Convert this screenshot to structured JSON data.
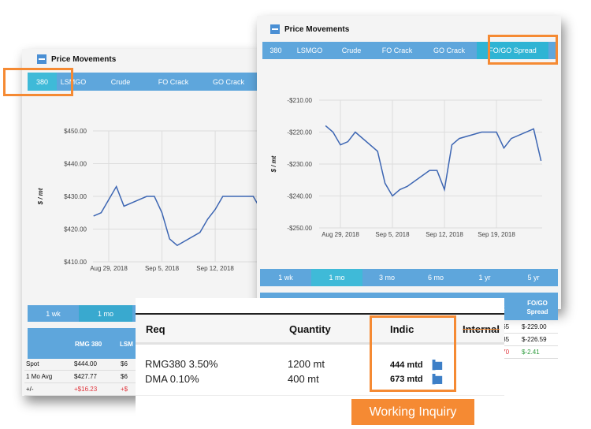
{
  "left_panel": {
    "title": "Price Movements",
    "tabs": [
      "380",
      "LSMGO",
      "Crude",
      "FO Crack",
      "GO Crack"
    ],
    "active_tab": "380",
    "periods": [
      "1 wk",
      "1 mo"
    ],
    "active_period": "1 mo",
    "table": {
      "headers": [
        "",
        "RMG 380",
        "LSM"
      ],
      "rows": [
        {
          "label": "Spot",
          "v1": "$444.00",
          "v2": "$6"
        },
        {
          "label": "1 Mo Avg",
          "v1": "$427.77",
          "v2": "$6"
        },
        {
          "label": "+/-",
          "v1": "+$16.23",
          "v2": "+$"
        }
      ]
    }
  },
  "right_panel": {
    "title": "Price Movements",
    "tabs": [
      "380",
      "LSMGO",
      "Crude",
      "FO Crack",
      "GO Crack",
      "FO/GO Spread"
    ],
    "active_tab": "FO/GO Spread",
    "periods": [
      "1 wk",
      "1 mo",
      "3 mo",
      "6 mo",
      "1 yr",
      "5 yr"
    ],
    "active_period": "1 mo",
    "table": {
      "headers": [
        "k",
        "FO/GO Spread"
      ],
      "rows": [
        {
          "v1": ".65",
          "v2": "$-229.00"
        },
        {
          "v1": ".35",
          "v2": "$-226.59"
        },
        {
          "v1": ".70",
          "v2": "$-2.41"
        }
      ]
    }
  },
  "inquiry": {
    "headers": {
      "req": "Req",
      "quantity": "Quantity",
      "indic": "Indic",
      "internal": "Internal"
    },
    "rows": [
      {
        "req": "RMG380 3.50%",
        "quantity": "1200 mt",
        "indic": "444 mtd"
      },
      {
        "req": "DMA 0.10%",
        "quantity": "400 mt",
        "indic": "673 mtd"
      }
    ],
    "badge": "Working Inquiry"
  },
  "colors": {
    "accent": "#f58a33",
    "tab": "#5ea6dc",
    "tab_active": "#3fbad8",
    "line": "#3d66b3",
    "negative": "#e0333a",
    "positive": "#2a9a3a"
  },
  "chart_data": [
    {
      "type": "line",
      "ylabel": "$ / mt",
      "ylim": [
        410,
        450
      ],
      "yticks": [
        "$410.00",
        "$420.00",
        "$430.00",
        "$440.00",
        "$450.00"
      ],
      "xticks": [
        "Aug 29, 2018",
        "Sep 5, 2018",
        "Sep 12, 2018",
        "Sep"
      ],
      "grid": true,
      "x": [
        "2018-08-27",
        "2018-08-28",
        "2018-08-30",
        "2018-08-31",
        "2018-09-03",
        "2018-09-04",
        "2018-09-05",
        "2018-09-06",
        "2018-09-07",
        "2018-09-10",
        "2018-09-11",
        "2018-09-12",
        "2018-09-13",
        "2018-09-17",
        "2018-09-18"
      ],
      "y": [
        424,
        425,
        433,
        427,
        430,
        430,
        425,
        417,
        415,
        419,
        423,
        426,
        430,
        430,
        426
      ]
    },
    {
      "type": "line",
      "ylabel": "$ / mt",
      "ylim": [
        -250,
        -210
      ],
      "yticks": [
        "-$250.00",
        "-$240.00",
        "-$230.00",
        "-$220.00",
        "-$210.00"
      ],
      "xticks": [
        "Aug 29, 2018",
        "Sep 5, 2018",
        "Sep 12, 2018",
        "Sep 19, 2018"
      ],
      "grid": true,
      "x": [
        "2018-08-27",
        "2018-08-28",
        "2018-08-29",
        "2018-08-30",
        "2018-08-31",
        "2018-09-03",
        "2018-09-04",
        "2018-09-05",
        "2018-09-06",
        "2018-09-07",
        "2018-09-10",
        "2018-09-11",
        "2018-09-12",
        "2018-09-13",
        "2018-09-14",
        "2018-09-17",
        "2018-09-19",
        "2018-09-20",
        "2018-09-21",
        "2018-09-24",
        "2018-09-25"
      ],
      "y": [
        -218,
        -220,
        -224,
        -223,
        -220,
        -226,
        -236,
        -240,
        -238,
        -237,
        -232,
        -232,
        -238,
        -224,
        -222,
        -220,
        -220,
        -225,
        -222,
        -219,
        -229
      ]
    }
  ]
}
